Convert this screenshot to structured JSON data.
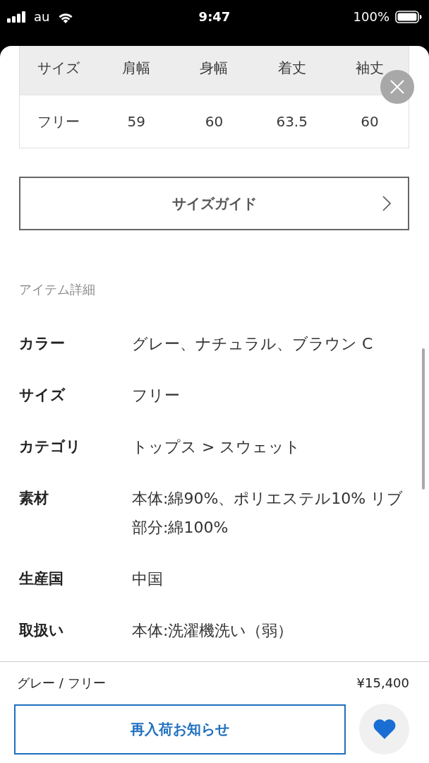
{
  "status_bar": {
    "carrier": "au",
    "time": "9:47",
    "battery": "100%"
  },
  "size_table": {
    "columns": [
      "サイズ",
      "肩幅",
      "身幅",
      "着丈",
      "袖丈"
    ],
    "rows": [
      [
        "フリー",
        "59",
        "60",
        "63.5",
        "60"
      ]
    ]
  },
  "size_guide_button": {
    "label": "サイズガイド"
  },
  "item_details": {
    "heading": "アイテム詳細",
    "rows": [
      {
        "label": "カラー",
        "value": "グレー、ナチュラル、ブラウン C"
      },
      {
        "label": "サイズ",
        "value": "フリー"
      },
      {
        "label": "カテゴリ",
        "value": "トップス > スウェット"
      },
      {
        "label": "素材",
        "value": "本体:綿90%、ポリエステル10% リブ部分:綿100%"
      },
      {
        "label": "生産国",
        "value": "中国"
      },
      {
        "label": "取扱い",
        "value": "本体:洗濯機洗い（弱）"
      }
    ]
  },
  "footer": {
    "selection": "グレー / フリー",
    "price": "¥15,400",
    "restock_button": "再入荷お知らせ",
    "favorite": {
      "selected": true
    }
  }
}
